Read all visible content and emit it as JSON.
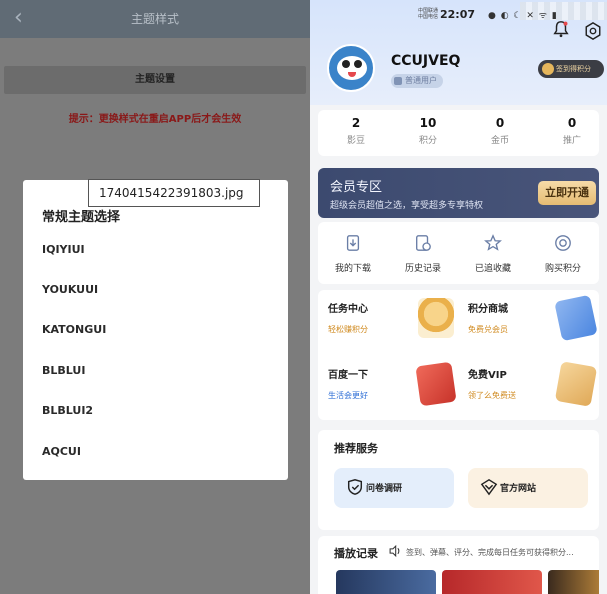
{
  "left": {
    "title": "主题样式",
    "back_glyph": "‹",
    "settings_label": "主题设置",
    "hint": "提示：更换样式在重启APP后才会生效",
    "dialog": {
      "title": "常规主题选择",
      "options": [
        "IQIYIUI",
        "YOUKUUI",
        "KATONGUI",
        "BLBLUI",
        "BLBLUI2",
        "AQCUI"
      ]
    },
    "file_tag": "1740415422391803.jpg"
  },
  "right": {
    "status": {
      "carrier": "中国联通\n中国电信",
      "time": "22:07",
      "icons": "● ◐ ☾ ✕ ᯤ ▮"
    },
    "username": "CCUJVEQ",
    "user_badge": "普通用户",
    "sign_button": "签到得积分",
    "stats": [
      {
        "value": "2",
        "label": "影豆"
      },
      {
        "value": "10",
        "label": "积分"
      },
      {
        "value": "0",
        "label": "金币"
      },
      {
        "value": "0",
        "label": "推广"
      }
    ],
    "vip": {
      "title": "会员专区",
      "subtitle": "超级会员超值之选，享受超多专享特权",
      "button": "立即开通"
    },
    "quick": [
      {
        "label": "我的下载",
        "icon": "download-icon"
      },
      {
        "label": "历史记录",
        "icon": "history-icon"
      },
      {
        "label": "已追收藏",
        "icon": "star-icon"
      },
      {
        "label": "购买积分",
        "icon": "points-icon"
      }
    ],
    "tasks": [
      {
        "title": "任务中心",
        "sub": "轻松赚积分",
        "sub_color": "#d08a1f",
        "icon": "coin-stack-icon"
      },
      {
        "title": "积分商城",
        "sub": "免费兑会员",
        "sub_color": "#d08a1f",
        "icon": "mall-icon"
      },
      {
        "title": "百度一下",
        "sub": "生活会更好",
        "sub_color": "#2f6fd6",
        "icon": "search-card-icon"
      },
      {
        "title": "免费VIP",
        "sub": "领了么免费送",
        "sub_color": "#d08a1f",
        "icon": "vip-gift-icon"
      }
    ],
    "services": {
      "title": "推荐服务",
      "items": [
        {
          "label": "问卷调研",
          "icon": "survey-icon"
        },
        {
          "label": "官方网站",
          "icon": "website-icon"
        }
      ]
    },
    "history": {
      "title": "播放记录",
      "subtitle": "签到、弹幕、评分、完成每日任务可获得积分..."
    }
  }
}
